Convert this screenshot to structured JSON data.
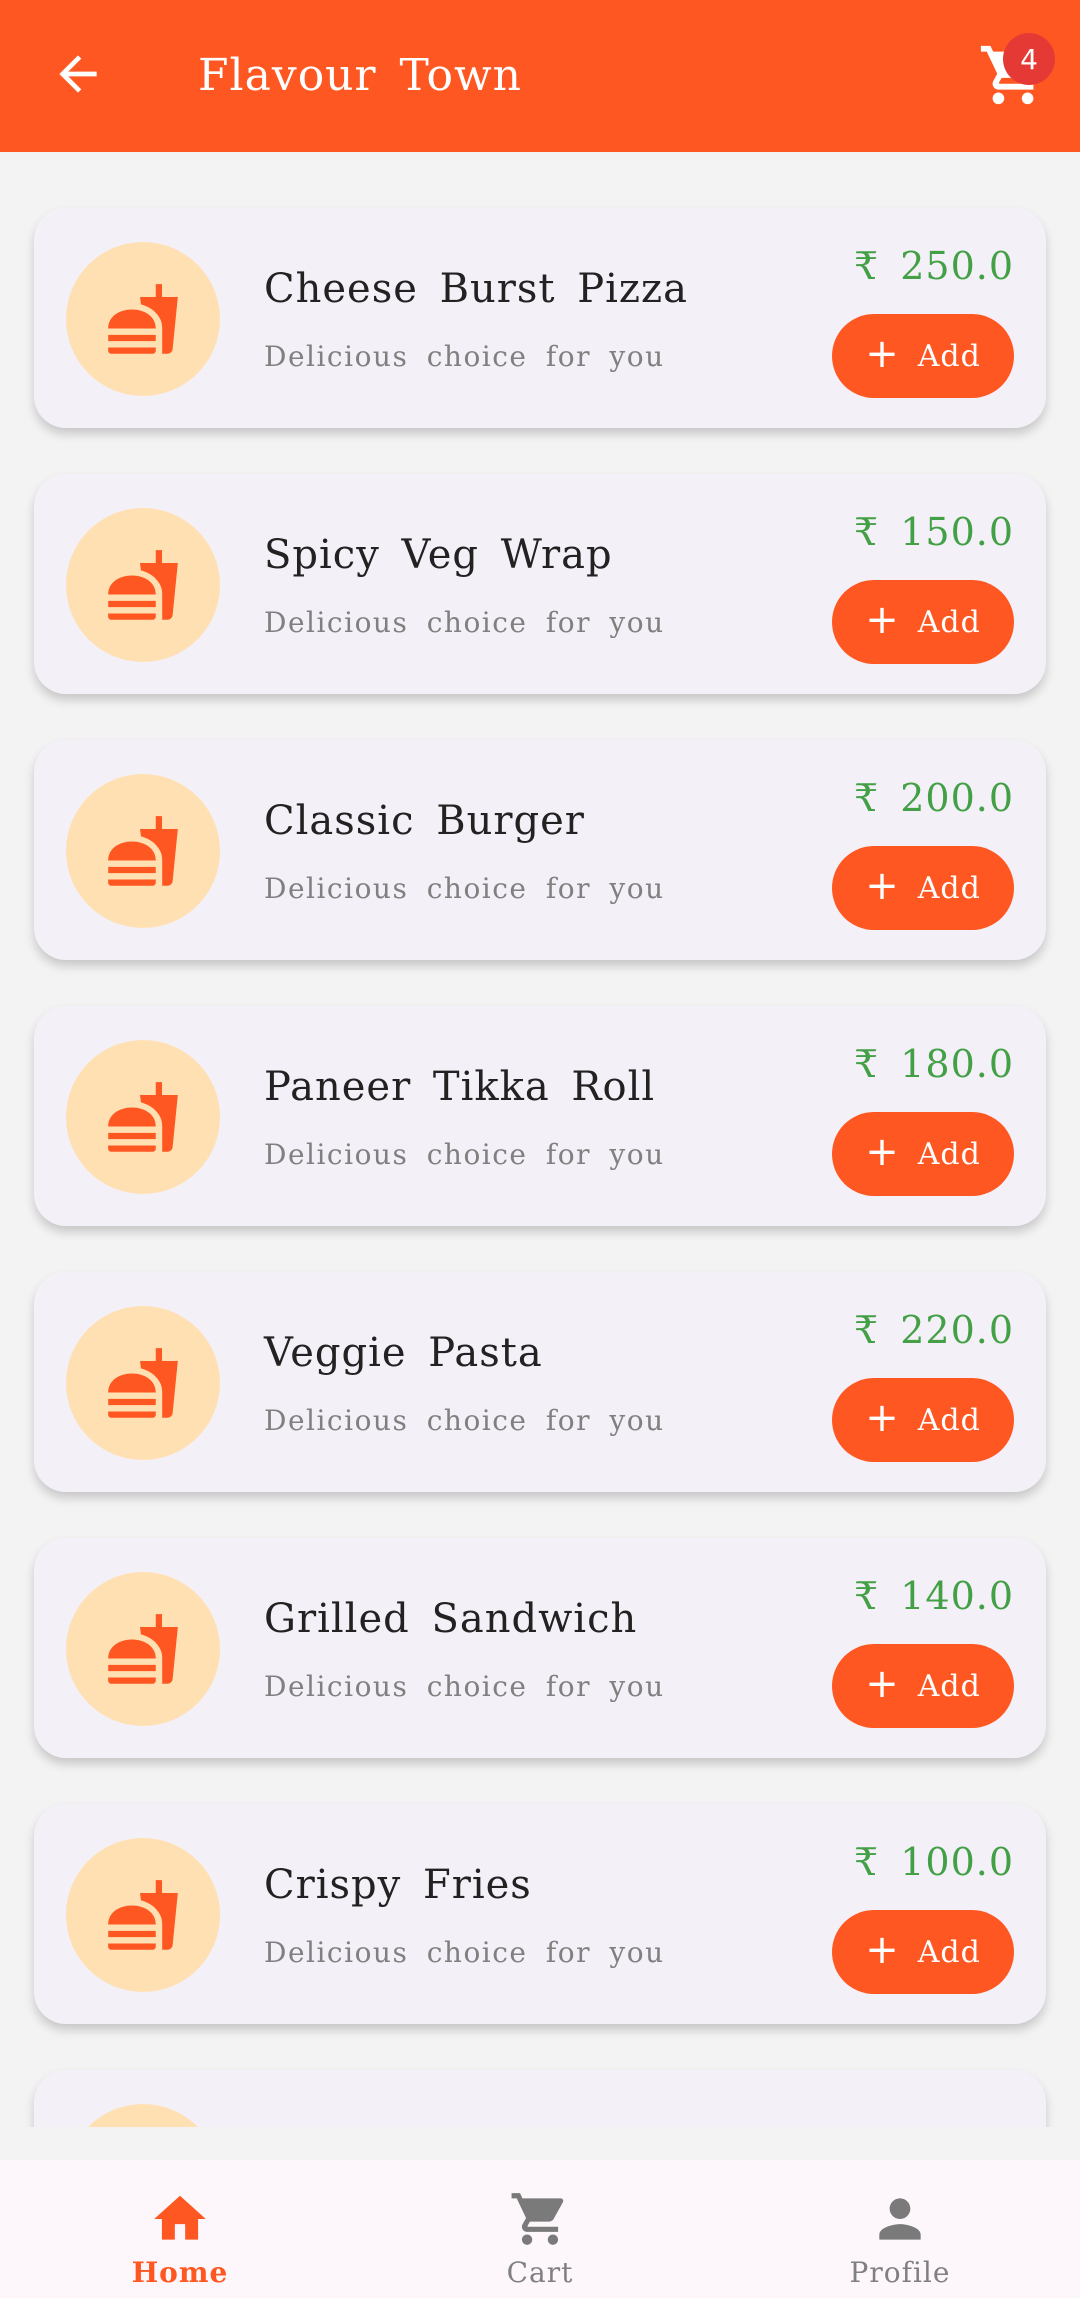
{
  "appbar": {
    "title": "Flavour Town",
    "cart_badge": "4"
  },
  "menu": {
    "items": [
      {
        "name": "Cheese Burst Pizza",
        "description": "Delicious choice for you",
        "price": "₹ 250.0",
        "add_label": "Add"
      },
      {
        "name": "Spicy Veg Wrap",
        "description": "Delicious choice for you",
        "price": "₹ 150.0",
        "add_label": "Add"
      },
      {
        "name": "Classic Burger",
        "description": "Delicious choice for you",
        "price": "₹ 200.0",
        "add_label": "Add"
      },
      {
        "name": "Paneer Tikka Roll",
        "description": "Delicious choice for you",
        "price": "₹ 180.0",
        "add_label": "Add"
      },
      {
        "name": "Veggie Pasta",
        "description": "Delicious choice for you",
        "price": "₹ 220.0",
        "add_label": "Add"
      },
      {
        "name": "Grilled Sandwich",
        "description": "Delicious choice for you",
        "price": "₹ 140.0",
        "add_label": "Add"
      },
      {
        "name": "Crispy Fries",
        "description": "Delicious choice for you",
        "price": "₹ 100.0",
        "add_label": "Add"
      }
    ]
  },
  "nav": {
    "home": "Home",
    "cart": "Cart",
    "profile": "Profile"
  },
  "colors": {
    "primary": "#ff5722",
    "price": "#43a047",
    "badge": "#e53935",
    "thumb_bg": "#ffe0b2"
  },
  "icons": {
    "back": "arrow-left-icon",
    "cart": "shopping-cart-icon",
    "food": "fastfood-icon",
    "home": "home-icon",
    "profile": "person-icon"
  }
}
